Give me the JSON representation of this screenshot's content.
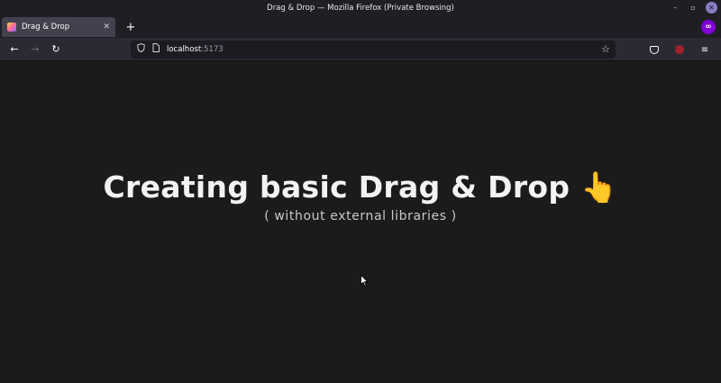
{
  "window": {
    "title": "Drag & Drop — Mozilla Firefox (Private Browsing)",
    "controls": {
      "minimize": "–",
      "maximize": "▫",
      "close": "✕"
    }
  },
  "tabs": [
    {
      "label": "Drag & Drop",
      "close": "✕",
      "active": true
    }
  ],
  "tabstrip": {
    "new_tab": "+",
    "private_badge": "∞"
  },
  "navbar": {
    "back": "←",
    "forward": "→",
    "reload": "↻",
    "url_host": "localhost",
    "url_port": ":5173",
    "bookmark": "☆",
    "menu": "≡"
  },
  "page": {
    "headline": "Creating basic Drag & Drop",
    "headline_emoji": "👆",
    "subline": "( without external libraries )"
  },
  "colors": {
    "background": "#1c1b1b",
    "headline": "#f3f3f3",
    "subline": "#c8c8c8",
    "private_purple": "#8000d7"
  }
}
